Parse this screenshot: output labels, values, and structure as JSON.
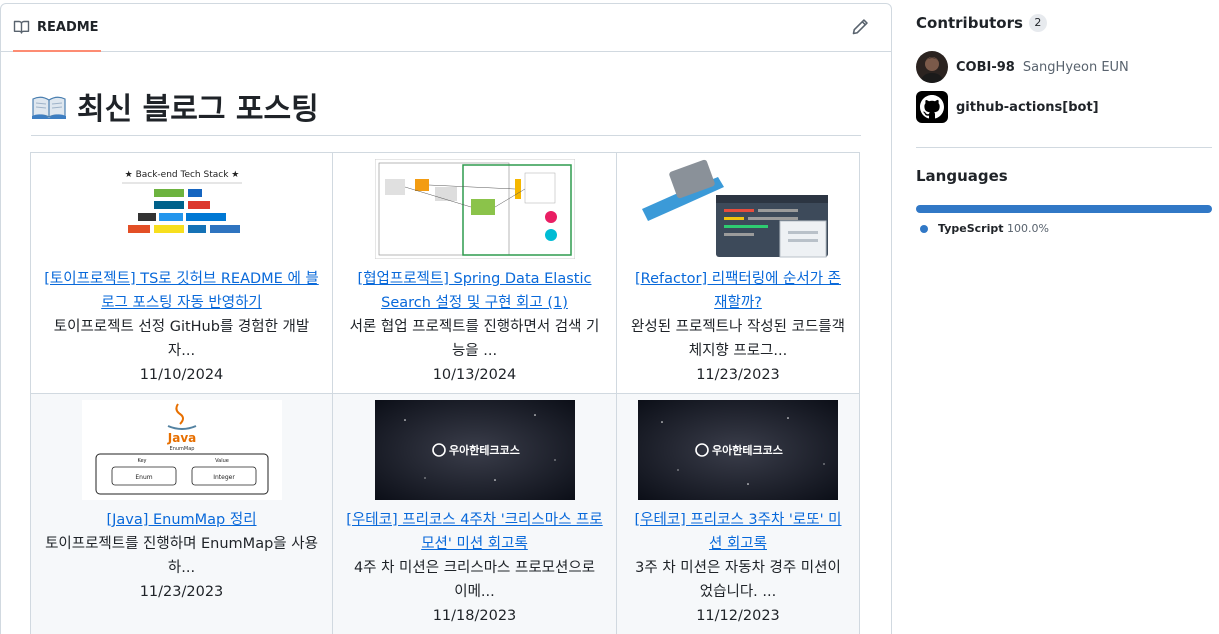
{
  "readme": {
    "tab_label": "README",
    "heading": "최신 블로그 포스팅"
  },
  "posts": [
    {
      "title": "[토이프로젝트] TS로 깃허브 README 에 블로그 포스팅 자동 반영하기",
      "desc": "토이프로젝트 선정 GitHub를 경험한 개발자...",
      "date": "11/10/2024",
      "thumb_text": "★ Back-end Tech Stack ★"
    },
    {
      "title": "[협업프로젝트] Spring Data Elastic Search 설정 및 구현 회고 (1)",
      "desc": "서론 협업 프로젝트를 진행하면서 검색 기능을 ...",
      "date": "10/13/2024"
    },
    {
      "title": "[Refactor] 리팩터링에 순서가 존재할까?",
      "desc": "완성된 프로젝트나 작성된 코드를객체지향 프로그...",
      "date": "11/23/2023"
    },
    {
      "title": "[Java] EnumMap 정리",
      "desc": "토이프로젝트를 진행하며 EnumMap을 사용하...",
      "date": "11/23/2023",
      "thumb_words": [
        "Java",
        "EnumMap",
        "Key",
        "Value",
        "Enum",
        "Integer"
      ]
    },
    {
      "title": "[우테코] 프리코스 4주차 '크리스마스 프로모션' 미션 회고록",
      "desc": "4주 차 미션은 크리스마스 프로모션으로 이메...",
      "date": "11/18/2023",
      "thumb_text": "우아한테크코스"
    },
    {
      "title": "[우테코] 프리코스 3주차 '로또' 미션 회고록",
      "desc": "3주 차 미션은 자동차 경주 미션이었습니다. ...",
      "date": "11/12/2023",
      "thumb_text": "우아한테크코스"
    }
  ],
  "sidebar": {
    "contributors_heading": "Contributors",
    "contributors_count": "2",
    "contributors": [
      {
        "login": "COBI-98",
        "name": "SangHyeon EUN"
      },
      {
        "login": "github-actions[bot]",
        "name": ""
      }
    ],
    "languages_heading": "Languages",
    "languages": [
      {
        "name": "TypeScript",
        "percent": "100.0%",
        "share": 1.0,
        "color": "#3178c6"
      }
    ]
  }
}
